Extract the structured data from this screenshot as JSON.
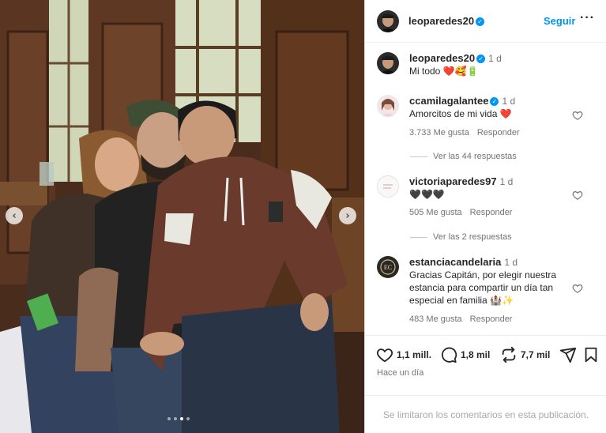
{
  "photo": {
    "prev_label": "‹",
    "next_label": "›",
    "carousel_count": 4,
    "carousel_active": 3
  },
  "header": {
    "username": "leoparedes20",
    "verified": "✓",
    "follow_label": "Seguir",
    "more_label": "···"
  },
  "caption": {
    "username": "leoparedes20",
    "verified": "✓",
    "time": "1 d",
    "text": "Mi todo ❤️🥰🔋"
  },
  "comments": [
    {
      "username": "ccamilagalantee",
      "verified": "✓",
      "time": "1 d",
      "text": "Amorcitos de mi vida ❤️",
      "likes": "3.733 Me gusta",
      "reply_label": "Responder",
      "replies_label": "Ver las 44 respuestas"
    },
    {
      "username": "victoriaparedes97",
      "time": "1 d",
      "text": "🖤🖤🖤",
      "likes": "505 Me gusta",
      "reply_label": "Responder",
      "replies_label": "Ver las 2 respuestas"
    },
    {
      "username": "estanciacandelaria",
      "time": "1 d",
      "text_line1": "Gracias Capitán, por elegir nuestra",
      "text_line2": "estancia para compartir un día tan",
      "text_line3": "especial en familia 🏰✨",
      "likes": "483 Me gusta",
      "reply_label": "Responder"
    }
  ],
  "actions": {
    "likes_count": "1,1 mill.",
    "comments_count": "1,8 mil",
    "reposts_count": "7,7 mil",
    "posted_ago": "Hace un día"
  },
  "footer": {
    "comments_closed": "Se limitaron los comentarios en esta publicación."
  },
  "colors": {
    "accent": "#0095f6",
    "heart_red": "#ed4956",
    "muted_text": "#737373"
  }
}
